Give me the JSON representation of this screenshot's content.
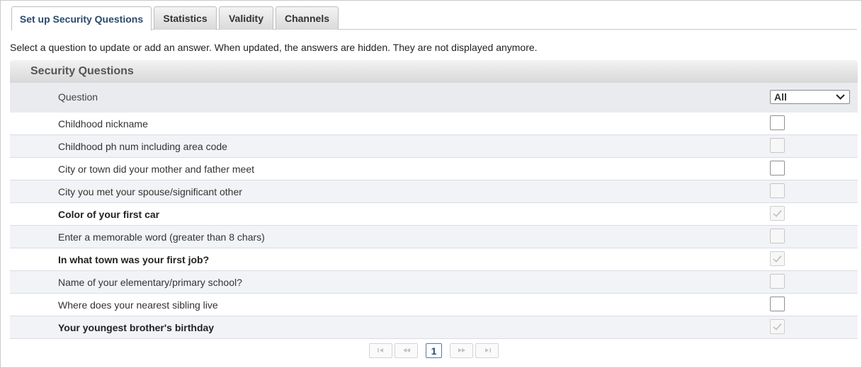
{
  "tabs": [
    {
      "label": "Set up Security Questions",
      "active": true
    },
    {
      "label": "Statistics",
      "active": false
    },
    {
      "label": "Validity",
      "active": false
    },
    {
      "label": "Channels",
      "active": false
    }
  ],
  "instructions": "Select a question to update or add an answer. When updated, the answers are hidden. They are not displayed anymore.",
  "panel": {
    "title": "Security Questions",
    "column_question": "Question",
    "filter": {
      "selected": "All"
    }
  },
  "questions": [
    {
      "text": "Childhood nickname",
      "answered": false,
      "state": "empty"
    },
    {
      "text": "Childhood ph num including area code",
      "answered": false,
      "state": "disabled"
    },
    {
      "text": "City or town did your mother and father meet",
      "answered": false,
      "state": "empty"
    },
    {
      "text": "City you met your spouse/significant other",
      "answered": false,
      "state": "disabled"
    },
    {
      "text": "Color of your first car",
      "answered": true,
      "state": "checked"
    },
    {
      "text": "Enter a memorable word (greater than 8 chars)",
      "answered": false,
      "state": "disabled"
    },
    {
      "text": "In what town was your first job?",
      "answered": true,
      "state": "checked"
    },
    {
      "text": "Name of your elementary/primary school?",
      "answered": false,
      "state": "disabled"
    },
    {
      "text": "Where does your nearest sibling live",
      "answered": false,
      "state": "empty"
    },
    {
      "text": "Your youngest brother's birthday",
      "answered": true,
      "state": "checked"
    }
  ],
  "pager": {
    "current_page": "1",
    "first_icon": "first-page-icon",
    "prev_icon": "prev-page-icon",
    "next_icon": "next-page-icon",
    "last_icon": "last-page-icon"
  },
  "colors": {
    "accent": "#2a4a6b",
    "row_alt": "#f1f3f7",
    "header_bg": "#e9ebee"
  }
}
